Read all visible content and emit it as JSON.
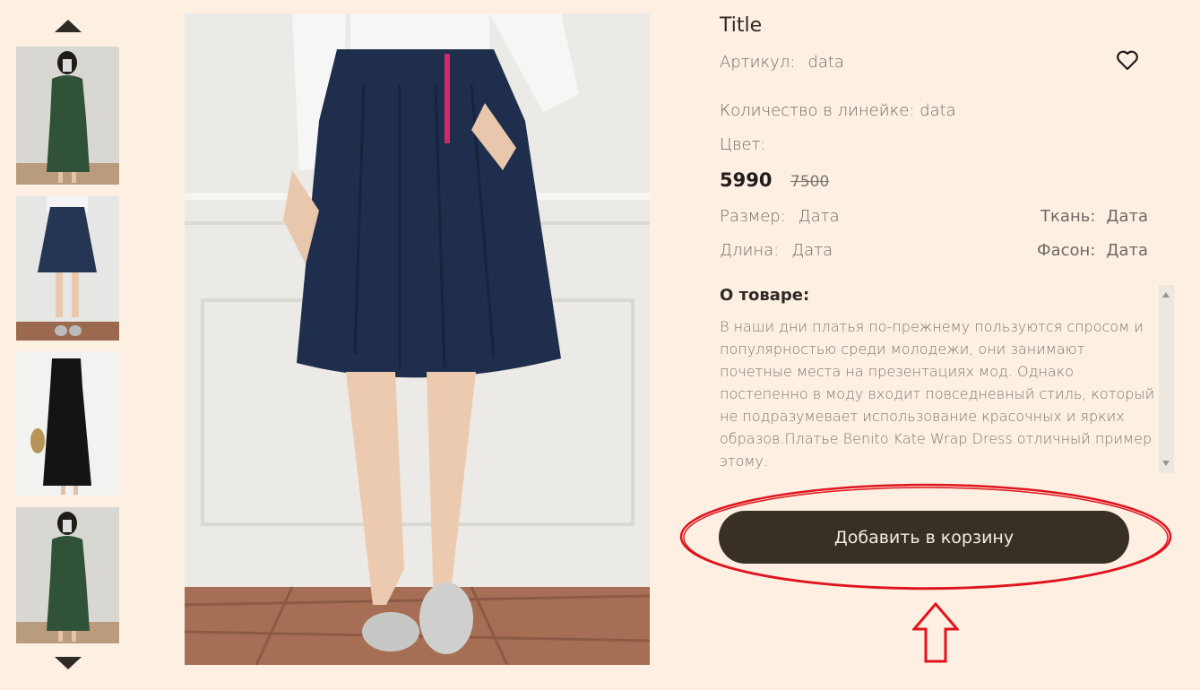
{
  "product": {
    "title": "Title",
    "article_label": "Артикул:",
    "article_value": "data",
    "quantity_text": "Количество в линейке: data",
    "color_label": "Цвет:",
    "price": "5990",
    "old_price": "7500",
    "size_label": "Размер:",
    "size_value": "Дата",
    "fabric_label": "Ткань:",
    "fabric_value": "Дата",
    "length_label": "Длина:",
    "length_value": "Дата",
    "style_label": "Фасон:",
    "style_value": "Дата",
    "about_title": "О товаре:",
    "description": "В наши дни платья по-прежнему пользуются спросом и популярностью среди молодежи, они занимают почетные места на презентациях мод. Однако постепенно в моду входит повседневный стиль, который не подразумевает использование красочных и ярких образов.Платье Benito Kate Wrap Dress отличный пример этому.",
    "add_to_cart": "Добавить в корзину"
  },
  "icons": {
    "gallery_up": "triangle-up-icon",
    "gallery_down": "triangle-down-icon",
    "favorite": "heart-outline-icon",
    "annotation_arrow": "red-up-arrow-icon"
  },
  "colors": {
    "background": "#fdf0e3",
    "button": "#382f26",
    "annotation": "#e0141e"
  }
}
